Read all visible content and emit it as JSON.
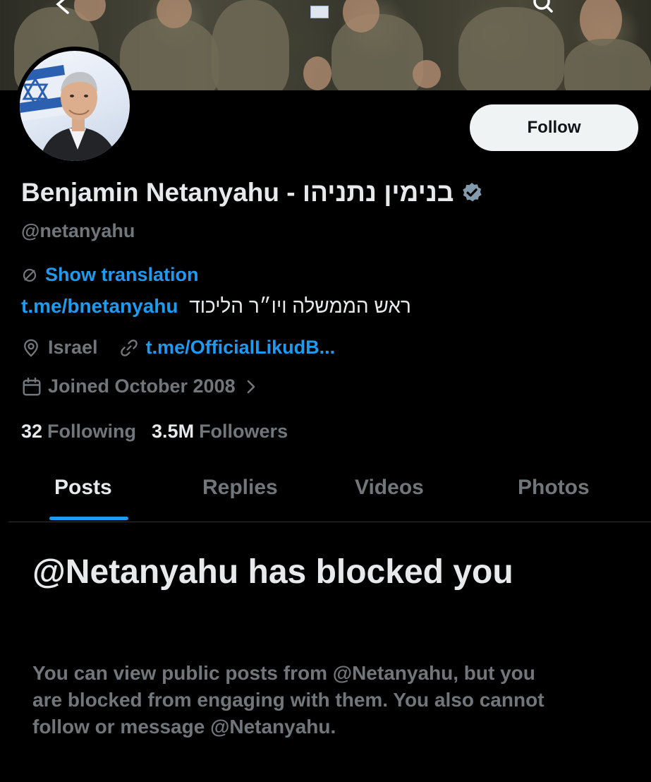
{
  "profile": {
    "display_name": "Benjamin Netanyahu - בנימין נתניהו",
    "handle": "@netanyahu",
    "show_translation": "Show translation",
    "bio_link": "t.me/bnetanyahu",
    "bio_text": "ראש הממשלה ויו״ר הליכוד",
    "location": "Israel",
    "website": "t.me/OfficialLikudB...",
    "joined": "Joined October 2008",
    "following_count": "32",
    "following_label": "Following",
    "followers_count": "3.5M",
    "followers_label": "Followers"
  },
  "actions": {
    "follow_label": "Follow"
  },
  "tabs": [
    {
      "label": "Posts",
      "active": true
    },
    {
      "label": "Replies",
      "active": false
    },
    {
      "label": "Videos",
      "active": false
    },
    {
      "label": "Photos",
      "active": false
    }
  ],
  "blocked": {
    "title": "@Netanyahu has blocked you",
    "description": "You can view public posts from @Netanyahu, but you are blocked from engaging with them. You also cannot follow or message @Netanyahu."
  },
  "icons": {
    "verified": "verified-badge-icon",
    "translate": "translate-icon",
    "location": "location-pin-icon",
    "link": "link-icon",
    "calendar": "calendar-icon",
    "chevron": "chevron-right-icon"
  },
  "colors": {
    "background": "#000000",
    "text_primary": "#e7e9ea",
    "text_secondary": "#71767b",
    "accent": "#1d9bf0",
    "follow_button_bg": "#eff3f4",
    "verified_badge": "#829aab"
  }
}
